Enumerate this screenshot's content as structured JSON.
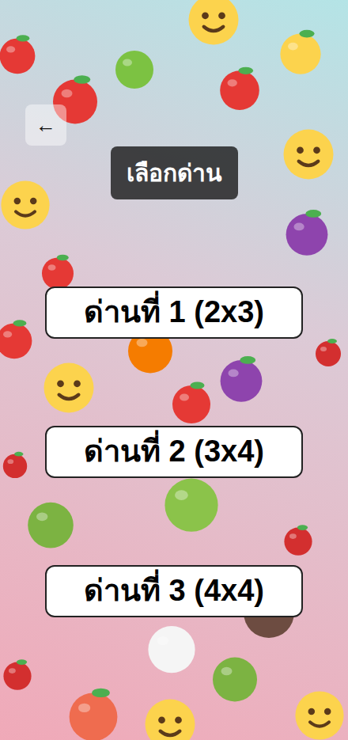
{
  "back_button": {
    "label": "←"
  },
  "title": "เลือกด่าน",
  "levels": [
    {
      "label": "ด่านที่ 1 (2x3)"
    },
    {
      "label": "ด่านที่ 2 (3x4)"
    },
    {
      "label": "ด่านที่ 3 (4x4)"
    }
  ]
}
